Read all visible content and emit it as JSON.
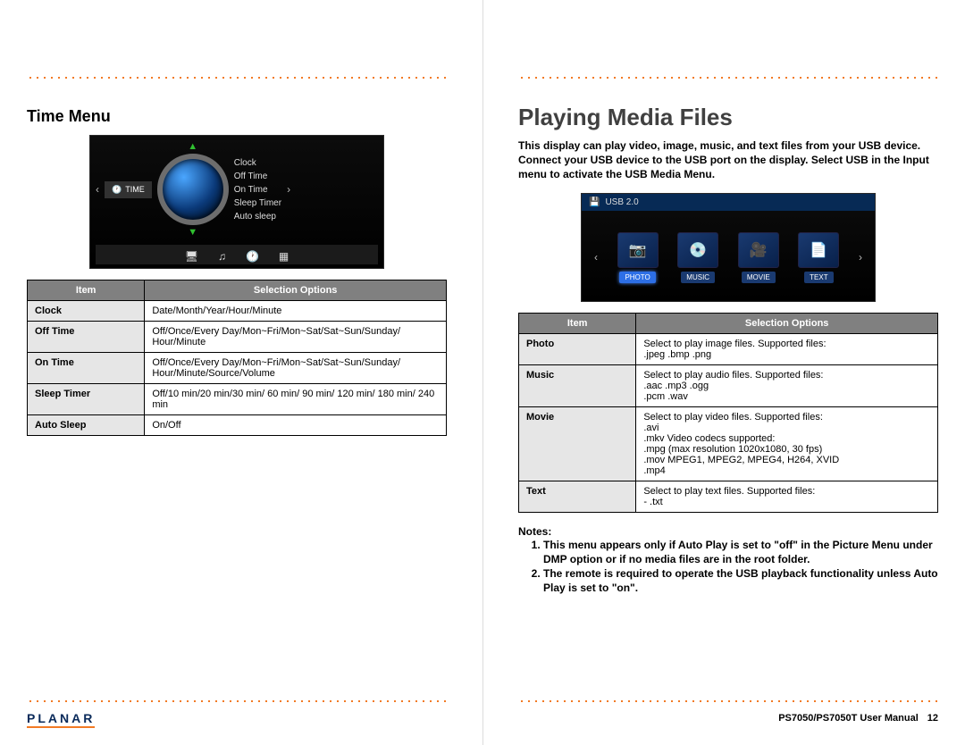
{
  "left": {
    "heading": "Time Menu",
    "osd": {
      "crumb_label": "TIME",
      "list": [
        "Clock",
        "Off Time",
        "On Time",
        "Sleep Timer",
        "Auto sleep"
      ],
      "bottom_icons": [
        "monitor-icon",
        "music-note-icon",
        "clock-icon",
        "grid-icon"
      ]
    },
    "table": {
      "head_item": "Item",
      "head_opts": "Selection Options",
      "rows": [
        {
          "item": "Clock",
          "opts": "Date/Month/Year/Hour/Minute"
        },
        {
          "item": "Off Time",
          "opts": "Off/Once/Every Day/Mon~Fri/Mon~Sat/Sat~Sun/Sunday/ Hour/Minute"
        },
        {
          "item": "On Time",
          "opts": "Off/Once/Every Day/Mon~Fri/Mon~Sat/Sat~Sun/Sunday/ Hour/Minute/Source/Volume"
        },
        {
          "item": "Sleep Timer",
          "opts": "Off/10 min/20 min/30 min/ 60 min/ 90 min/ 120 min/ 180 min/ 240 min"
        },
        {
          "item": "Auto Sleep",
          "opts": "On/Off"
        }
      ]
    },
    "footer_logo": "PLANAR"
  },
  "right": {
    "heading": "Playing Media Files",
    "intro": "This display can play video, image, music, and text files from your USB device. Connect your USB device to the USB port on the display. Select USB in the Input menu to activate the USB Media Menu.",
    "osd": {
      "title": "USB 2.0",
      "items": [
        {
          "label": "PHOTO",
          "icon": "camera-icon"
        },
        {
          "label": "MUSIC",
          "icon": "disc-icon"
        },
        {
          "label": "MOVIE",
          "icon": "film-icon"
        },
        {
          "label": "TEXT",
          "icon": "text-icon"
        }
      ]
    },
    "table": {
      "head_item": "Item",
      "head_opts": "Selection Options",
      "rows": [
        {
          "item": "Photo",
          "opts": "Select to play image files.  Supported  files:\n.jpeg                    .bmp                    .png"
        },
        {
          "item": "Music",
          "opts": "Select to play audio files.  Supported  files:\n.aac                     .mp3                              .ogg\n.pcm                    .wav"
        },
        {
          "item": "Movie",
          "opts": "Select to play video files.  Supported  files:\n.avi\n.mkv                         Video codecs supported:\n.mpg                         (max resolution 1020x1080, 30 fps)\n.mov                         MPEG1, MPEG2, MPEG4, H264, XVID\n.mp4"
        },
        {
          "item": "Text",
          "opts": "Select to play text files.  Supported  files:\n- .txt"
        }
      ]
    },
    "notes_head": "Notes:",
    "notes": [
      "This menu appears only if Auto Play is set to \"off\" in the Picture Menu under DMP option or if no media files are in the root folder.",
      "The remote is required to operate the USB playback functionality unless Auto Play is set to \"on\"."
    ],
    "footer_doc": "PS7050/PS7050T User Manual",
    "footer_page": "12"
  }
}
